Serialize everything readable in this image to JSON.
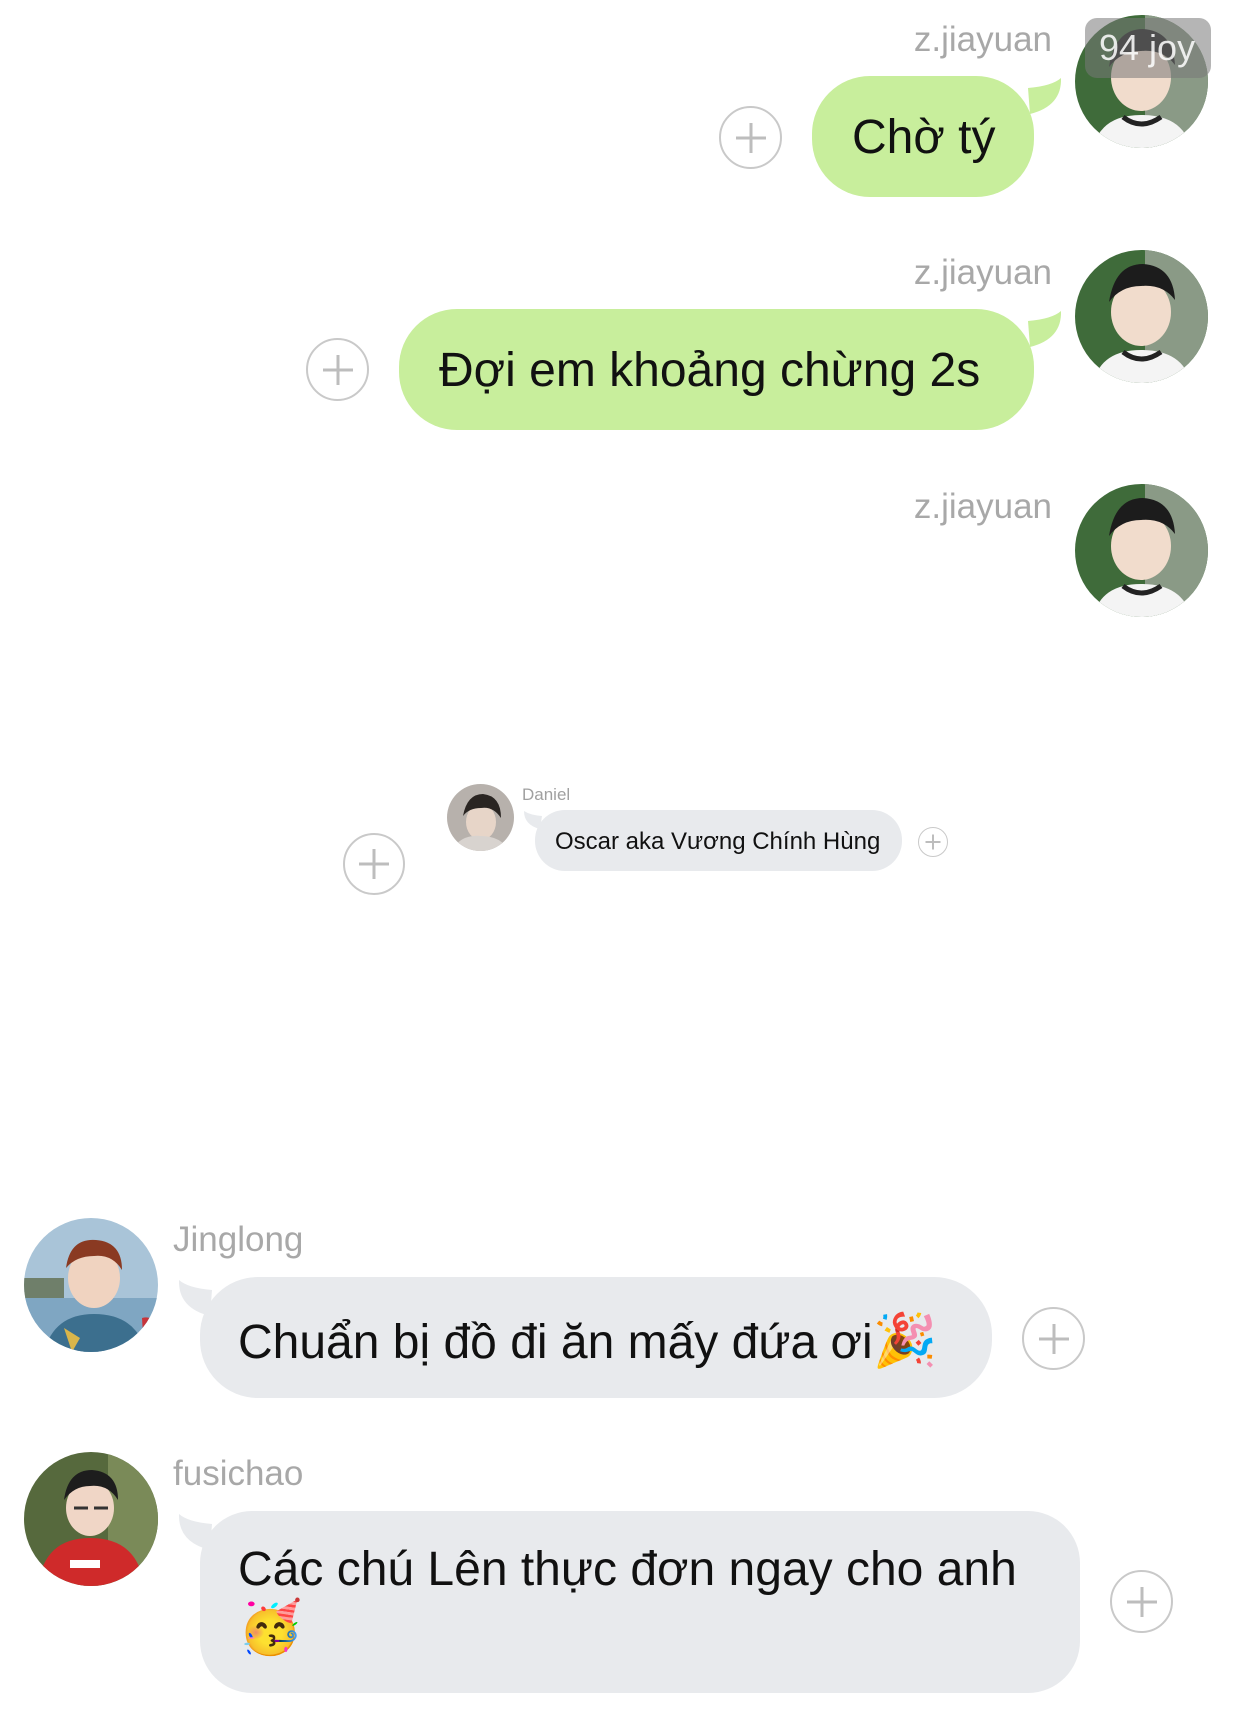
{
  "watermark": "94 joy",
  "messages": [
    {
      "sender": "z.jiayuan",
      "text": "Chờ tý"
    },
    {
      "sender": "z.jiayuan",
      "text": "Đợi em khoảng chừng 2s"
    },
    {
      "sender": "z.jiayuan",
      "text": ""
    }
  ],
  "embedded": {
    "sender": "Daniel",
    "text": "Oscar aka Vương Chính Hùng"
  },
  "incoming": [
    {
      "sender": "Jinglong",
      "text": "Chuẩn bị đồ đi ăn mấy đứa ơi",
      "emoji": "🎉"
    },
    {
      "sender": "fusichao",
      "line1": "Các chú Lên thực đơn ngay cho anh",
      "emoji": "🥳"
    }
  ],
  "colors": {
    "outgoing_bubble": "#c8ee9c",
    "incoming_bubble": "#e8eaed",
    "name": "#a8a8a8"
  }
}
